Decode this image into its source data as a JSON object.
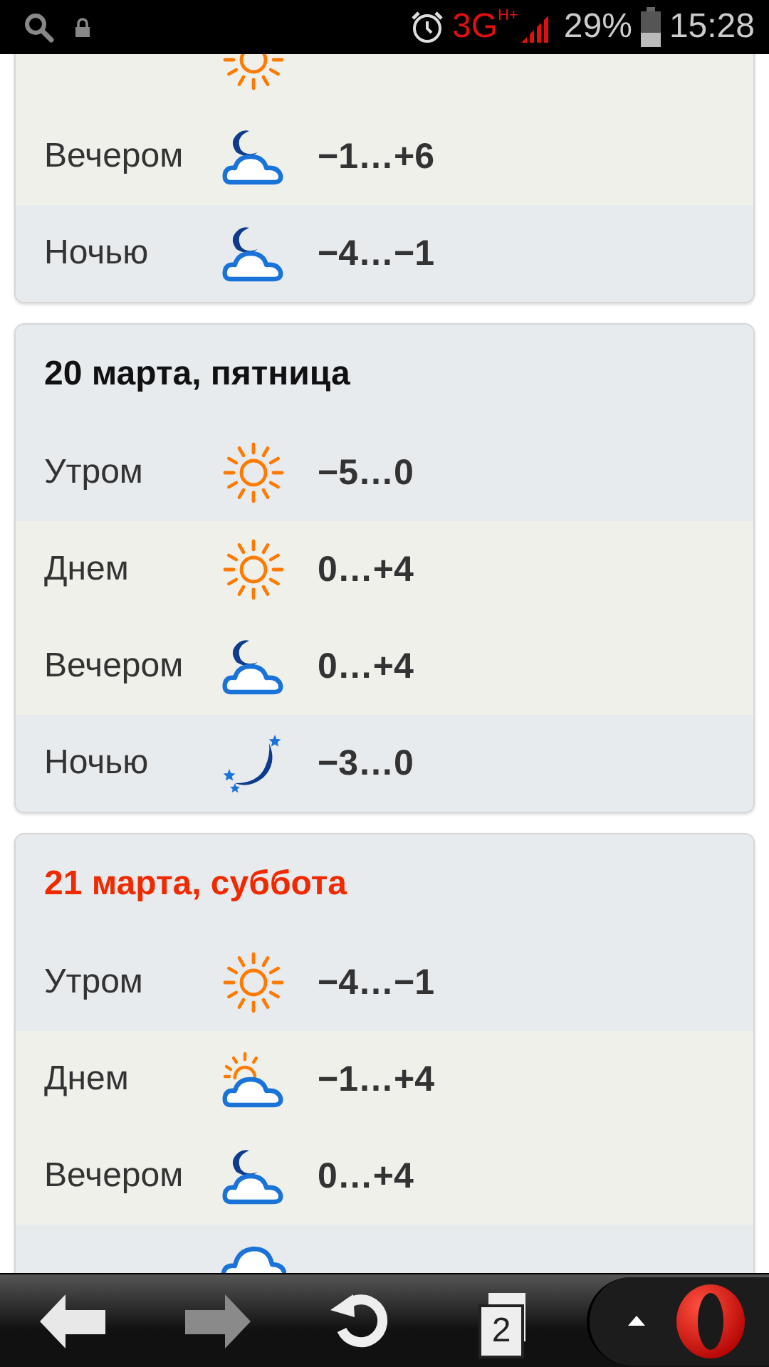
{
  "status_bar": {
    "network": "3G",
    "network_sub": "H+",
    "battery": "29%",
    "time": "15:28"
  },
  "days": [
    {
      "periods": [
        {
          "kind": "sun"
        },
        {
          "label": "Вечером",
          "kind": "moon-cloud",
          "temp": "−1…+6"
        },
        {
          "label": "Ночью",
          "kind": "moon-cloud",
          "temp": "−4…−1"
        }
      ]
    },
    {
      "title": "20 марта, пятница",
      "weekend": false,
      "periods": [
        {
          "label": "Утром",
          "kind": "sun",
          "temp": "−5…0"
        },
        {
          "label": "Днем",
          "kind": "sun",
          "temp": "0…+4"
        },
        {
          "label": "Вечером",
          "kind": "moon-cloud",
          "temp": "0…+4"
        },
        {
          "label": "Ночью",
          "kind": "moon-stars",
          "temp": "−3…0"
        }
      ]
    },
    {
      "title": "21 марта, суббота",
      "weekend": true,
      "periods": [
        {
          "label": "Утром",
          "kind": "sun",
          "temp": "−4…−1"
        },
        {
          "label": "Днем",
          "kind": "sun-cloud",
          "temp": "−1…+4"
        },
        {
          "label": "Вечером",
          "kind": "moon-cloud",
          "temp": "0…+4"
        },
        {
          "kind": "cloud"
        }
      ]
    }
  ],
  "toolbar": {
    "forward_disabled": true,
    "tab_count": "2"
  }
}
